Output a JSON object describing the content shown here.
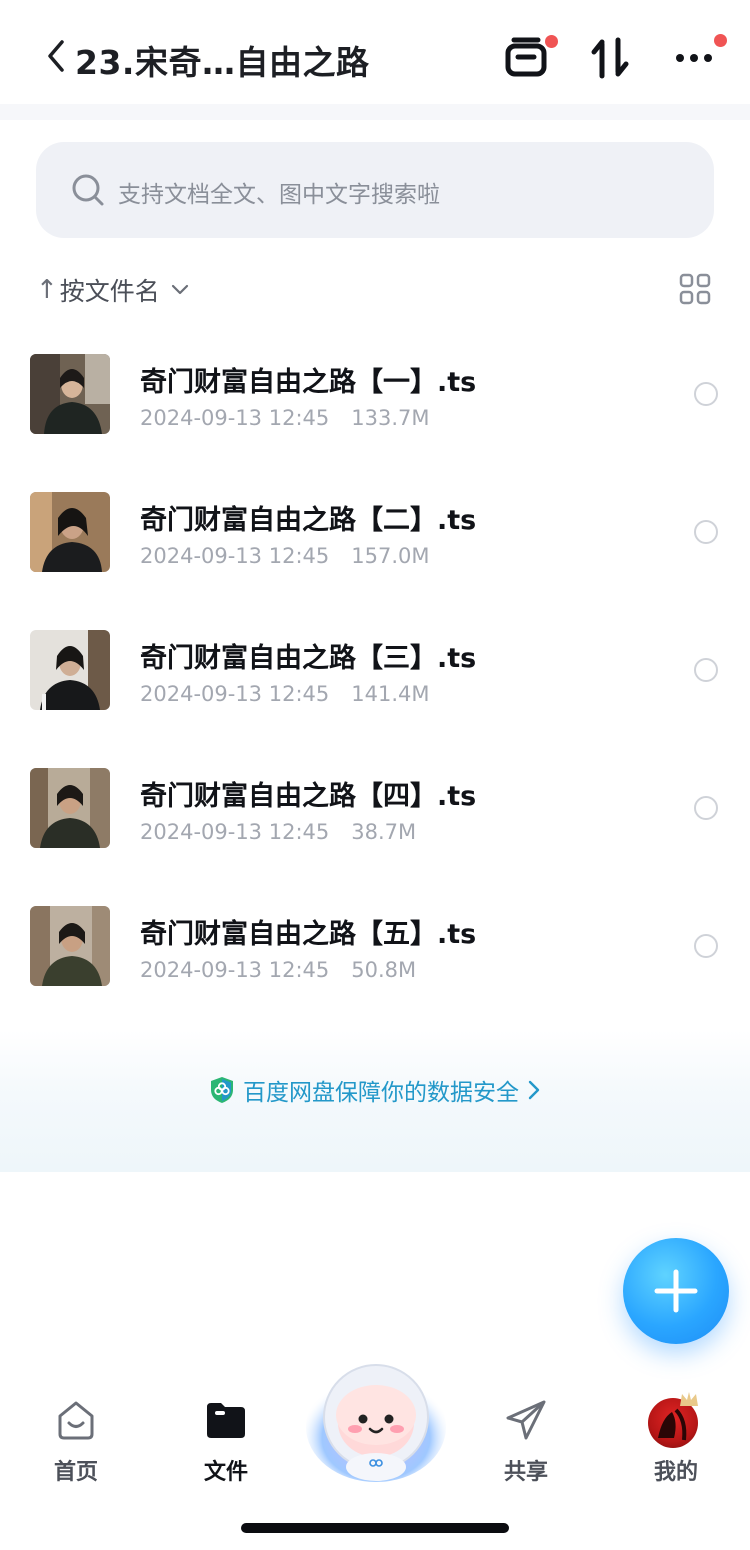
{
  "header": {
    "title": "23.宋奇…自由之路"
  },
  "search": {
    "placeholder": "支持文档全文、图中文字搜索啦"
  },
  "sort": {
    "arrow": "↑",
    "label": "按文件名"
  },
  "files": [
    {
      "name": "奇门财富自由之路【一】.ts",
      "date": "2024-09-13 12:45",
      "size": "133.7M"
    },
    {
      "name": "奇门财富自由之路【二】.ts",
      "date": "2024-09-13 12:45",
      "size": "157.0M"
    },
    {
      "name": "奇门财富自由之路【三】.ts",
      "date": "2024-09-13 12:45",
      "size": "141.4M"
    },
    {
      "name": "奇门财富自由之路【四】.ts",
      "date": "2024-09-13 12:45",
      "size": "38.7M"
    },
    {
      "name": "奇门财富自由之路【五】.ts",
      "date": "2024-09-13 12:45",
      "size": "50.8M"
    }
  ],
  "banner": {
    "text": "百度网盘保障你的数据安全"
  },
  "nav": {
    "home": "首页",
    "files": "文件",
    "share": "共享",
    "mine": "我的"
  },
  "colors": {
    "accent": "#2398c9",
    "fab": "#2aa6ff",
    "notification_dot": "#f05454"
  }
}
